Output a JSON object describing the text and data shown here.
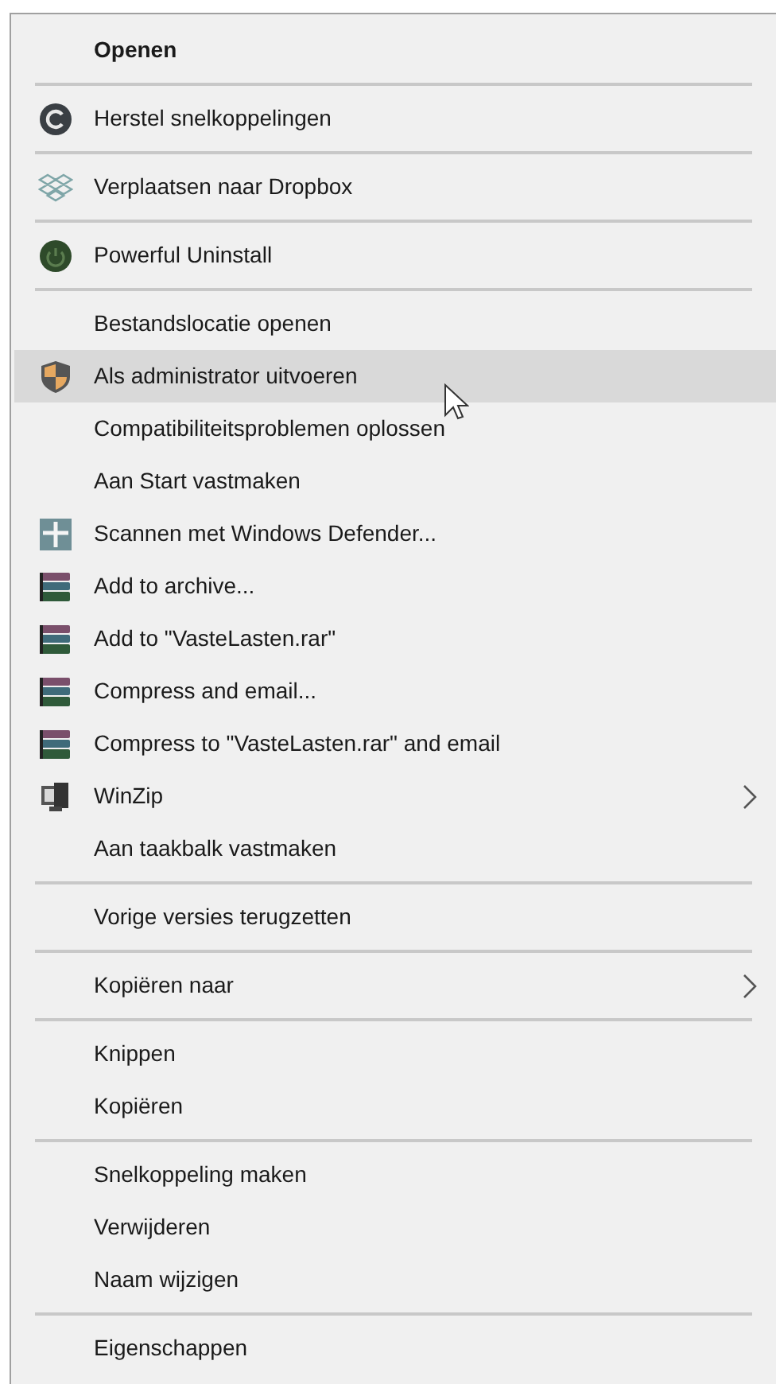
{
  "menu": {
    "groups": [
      [
        {
          "label": "Openen",
          "kind": "plain",
          "default": true,
          "selected": false,
          "submenu": false
        }
      ],
      [
        {
          "label": "Herstel snelkoppelingen",
          "kind": "restore",
          "default": false,
          "selected": false,
          "submenu": false
        }
      ],
      [
        {
          "label": "Verplaatsen naar Dropbox",
          "kind": "dropbox",
          "default": false,
          "selected": false,
          "submenu": false
        }
      ],
      [
        {
          "label": "Powerful Uninstall",
          "kind": "uninstall",
          "default": false,
          "selected": false,
          "submenu": false
        }
      ],
      [
        {
          "label": "Bestandslocatie openen",
          "kind": "plain",
          "default": false,
          "selected": false,
          "submenu": false
        },
        {
          "label": "Als administrator uitvoeren",
          "kind": "shield",
          "default": false,
          "selected": true,
          "submenu": false
        },
        {
          "label": "Compatibiliteitsproblemen oplossen",
          "kind": "plain",
          "default": false,
          "selected": false,
          "submenu": false
        },
        {
          "label": "Aan Start vastmaken",
          "kind": "plain",
          "default": false,
          "selected": false,
          "submenu": false
        },
        {
          "label": "Scannen met Windows Defender...",
          "kind": "defender",
          "default": false,
          "selected": false,
          "submenu": false
        },
        {
          "label": "Add to archive...",
          "kind": "rar",
          "default": false,
          "selected": false,
          "submenu": false
        },
        {
          "label": "Add to \"VasteLasten.rar\"",
          "kind": "rar",
          "default": false,
          "selected": false,
          "submenu": false
        },
        {
          "label": "Compress and email...",
          "kind": "rar",
          "default": false,
          "selected": false,
          "submenu": false
        },
        {
          "label": "Compress to \"VasteLasten.rar\" and email",
          "kind": "rar",
          "default": false,
          "selected": false,
          "submenu": false
        },
        {
          "label": "WinZip",
          "kind": "winzip",
          "default": false,
          "selected": false,
          "submenu": true
        },
        {
          "label": "Aan taakbalk vastmaken",
          "kind": "plain",
          "default": false,
          "selected": false,
          "submenu": false
        }
      ],
      [
        {
          "label": "Vorige versies terugzetten",
          "kind": "plain",
          "default": false,
          "selected": false,
          "submenu": false
        }
      ],
      [
        {
          "label": "Kopiëren naar",
          "kind": "plain",
          "default": false,
          "selected": false,
          "submenu": true
        }
      ],
      [
        {
          "label": "Knippen",
          "kind": "plain",
          "default": false,
          "selected": false,
          "submenu": false
        },
        {
          "label": "Kopiëren",
          "kind": "plain",
          "default": false,
          "selected": false,
          "submenu": false
        }
      ],
      [
        {
          "label": "Snelkoppeling maken",
          "kind": "plain",
          "default": false,
          "selected": false,
          "submenu": false
        },
        {
          "label": "Verwijderen",
          "kind": "plain",
          "default": false,
          "selected": false,
          "submenu": false
        },
        {
          "label": "Naam wijzigen",
          "kind": "plain",
          "default": false,
          "selected": false,
          "submenu": false
        }
      ],
      [
        {
          "label": "Eigenschappen",
          "kind": "plain",
          "default": false,
          "selected": false,
          "submenu": false
        }
      ]
    ]
  }
}
